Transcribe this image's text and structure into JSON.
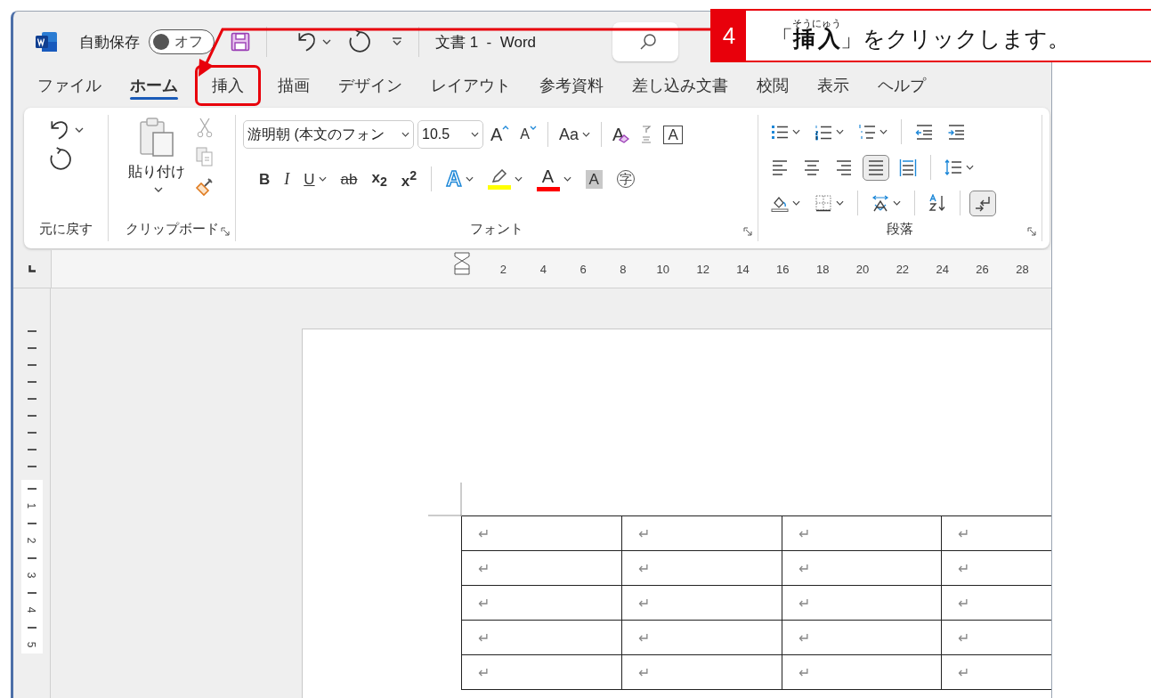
{
  "window": {
    "title": "文書 1  -  Word"
  },
  "quick_access": {
    "autosave_label": "自動保存",
    "autosave_state": "オフ",
    "autosave_on": false
  },
  "callout": {
    "step": "4",
    "before": "「",
    "ruby_base": "挿入",
    "ruby": "そうにゅう",
    "after": "」をクリックします。"
  },
  "tabs": [
    {
      "label": "ファイル",
      "selected": false,
      "highlighted": false
    },
    {
      "label": "ホーム",
      "selected": true,
      "highlighted": false
    },
    {
      "label": "挿入",
      "selected": false,
      "highlighted": true
    },
    {
      "label": "描画",
      "selected": false,
      "highlighted": false
    },
    {
      "label": "デザイン",
      "selected": false,
      "highlighted": false
    },
    {
      "label": "レイアウト",
      "selected": false,
      "highlighted": false
    },
    {
      "label": "参考資料",
      "selected": false,
      "highlighted": false
    },
    {
      "label": "差し込み文書",
      "selected": false,
      "highlighted": false
    },
    {
      "label": "校閲",
      "selected": false,
      "highlighted": false
    },
    {
      "label": "表示",
      "selected": false,
      "highlighted": false
    },
    {
      "label": "ヘルプ",
      "selected": false,
      "highlighted": false
    }
  ],
  "ribbon": {
    "undo_group": {
      "label": "元に戻す"
    },
    "clipboard_group": {
      "label": "クリップボード",
      "paste_label": "貼り付け"
    },
    "font_group": {
      "label": "フォント",
      "font_name": "游明朝 (本文のフォン",
      "font_size": "10.5",
      "row1": [
        {
          "kind": "grow",
          "label": "A",
          "dropdown": false
        },
        {
          "kind": "shrink",
          "label": "A",
          "dropdown": false
        },
        {
          "kind": "case",
          "label": "Aa",
          "dropdown": true
        },
        {
          "kind": "clear",
          "label": "A",
          "dropdown": false
        },
        {
          "kind": "phonetic",
          "dropdown": false
        },
        {
          "kind": "border",
          "label": "A",
          "dropdown": false
        }
      ],
      "row2": [
        {
          "kind": "bold",
          "label": "B",
          "dropdown": false
        },
        {
          "kind": "italic",
          "label": "I",
          "dropdown": false
        },
        {
          "kind": "underline",
          "label": "U",
          "dropdown": true
        },
        {
          "kind": "strike",
          "label": "ab",
          "dropdown": false
        },
        {
          "kind": "subscript",
          "label": "x$_{2}$",
          "dropdown": false
        },
        {
          "kind": "superscript",
          "label": "x$^{2}$",
          "dropdown": false
        },
        {
          "kind": "effect",
          "label": "A",
          "dropdown": true
        },
        {
          "kind": "highlight",
          "dropdown": true,
          "color": "#ffff00"
        },
        {
          "kind": "fontcolor",
          "label": "A",
          "dropdown": true,
          "color": "#ff0000"
        },
        {
          "kind": "shade",
          "label": "A",
          "dropdown": false
        },
        {
          "kind": "enclose",
          "label": "字",
          "dropdown": false
        }
      ]
    },
    "paragraph_group": {
      "label": "段落",
      "rows": [
        [
          {
            "kind": "bullets",
            "dropdown": true,
            "selected": false
          },
          {
            "kind": "numbering",
            "dropdown": true,
            "selected": false
          },
          {
            "kind": "multilevel",
            "dropdown": true,
            "selected": false
          },
          {
            "kind": "outdent",
            "dropdown": false,
            "selected": false
          },
          {
            "kind": "indent",
            "dropdown": false,
            "selected": false
          }
        ],
        [
          {
            "kind": "left",
            "dropdown": false,
            "selected": false
          },
          {
            "kind": "center",
            "dropdown": false,
            "selected": false
          },
          {
            "kind": "right",
            "dropdown": false,
            "selected": false
          },
          {
            "kind": "justify",
            "dropdown": false,
            "selected": true
          },
          {
            "kind": "distribute",
            "dropdown": false,
            "selected": false
          },
          {
            "kind": "spacing",
            "dropdown": true,
            "selected": false
          }
        ],
        [
          {
            "kind": "shading",
            "dropdown": true,
            "selected": false
          },
          {
            "kind": "borders",
            "dropdown": true,
            "selected": false
          },
          {
            "kind": "asian",
            "dropdown": true,
            "selected": false
          },
          {
            "kind": "sort",
            "dropdown": false,
            "selected": false
          },
          {
            "kind": "marks",
            "dropdown": false,
            "selected": true
          }
        ]
      ]
    }
  },
  "ruler": {
    "numbers": [
      "2",
      "4",
      "6",
      "8",
      "10",
      "12",
      "14",
      "16",
      "18",
      "20",
      "22",
      "24",
      "26",
      "28"
    ]
  },
  "vertical_ruler": {
    "numbers": [
      "1",
      "2",
      "3",
      "4",
      "5"
    ]
  },
  "table": {
    "rows": [
      [
        "↵",
        "↵",
        "↵",
        "↵"
      ],
      [
        "↵",
        "↵",
        "↵",
        "↵"
      ],
      [
        "↵",
        "↵",
        "↵",
        "↵"
      ],
      [
        "↵",
        "↵",
        "↵",
        "↵"
      ],
      [
        "↵",
        "↵",
        "↵",
        "↵"
      ]
    ]
  }
}
